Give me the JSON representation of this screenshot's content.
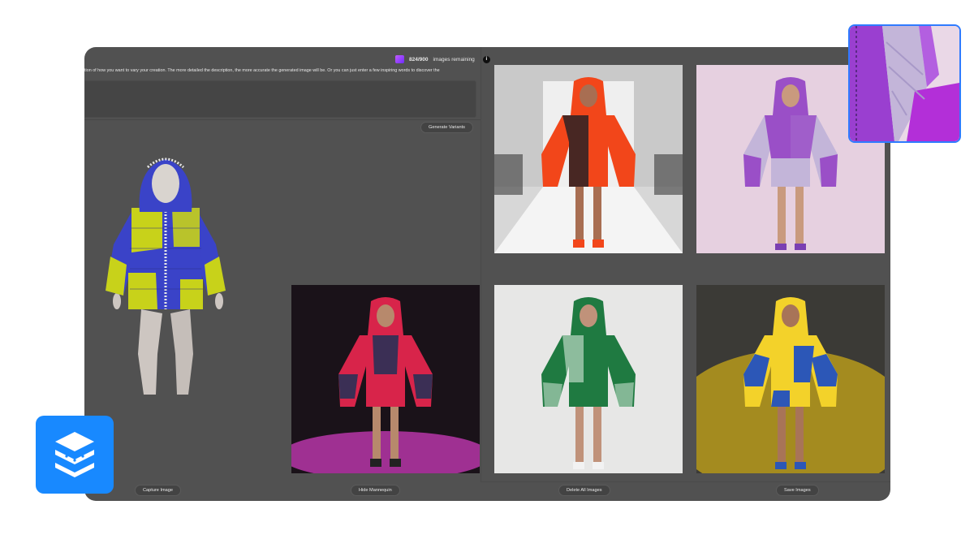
{
  "quota": {
    "count": "824/900",
    "label": "images remaining",
    "info": "i"
  },
  "instructions": "tion of how you want to vary your creation. The more detailed the description, the more accurate the generated image will be. Or you can just enter a few inspiring words to discover the",
  "prompt": {
    "value": "",
    "placeholder": ""
  },
  "buttons": {
    "generate_variants": "Generate Variants",
    "capture_image": "Capture Image",
    "hide_mannequin": "Hide Mannequin",
    "delete_all_images": "Delete All Images",
    "save_images": "Save Images"
  },
  "generated_images": [
    {
      "id": "orange-black-quilted-jacket-runway",
      "jacket": "#f2461a",
      "accent": "#2a2226",
      "backdrop": "#cfcfcf"
    },
    {
      "id": "purple-lilac-metallic-jacket",
      "jacket": "#9a4fc7",
      "accent": "#c3b5d9",
      "backdrop": "#e6d0e0"
    },
    {
      "id": "red-purple-jacket-dark-stage",
      "jacket": "#d8244a",
      "accent": "#3b2f55",
      "backdrop": "#1a1219"
    },
    {
      "id": "green-patterned-jacket",
      "jacket": "#1f7a41",
      "accent": "#e8f3ea",
      "backdrop": "#e7e7e6"
    },
    {
      "id": "yellow-blue-jacket",
      "jacket": "#f3d22a",
      "accent": "#2c57b7",
      "backdrop": "#b79a1b"
    }
  ],
  "mannequin": {
    "jacket": "#3a43c8",
    "accent": "#c8d21a",
    "body": "#cdc6c1"
  },
  "colors": {
    "window": "#515151",
    "brand_badge": "#1889ff",
    "inset_border": "#2f7bff"
  },
  "icons": {
    "quota": "gallery-icon",
    "brand": "layers-stack-icon"
  }
}
